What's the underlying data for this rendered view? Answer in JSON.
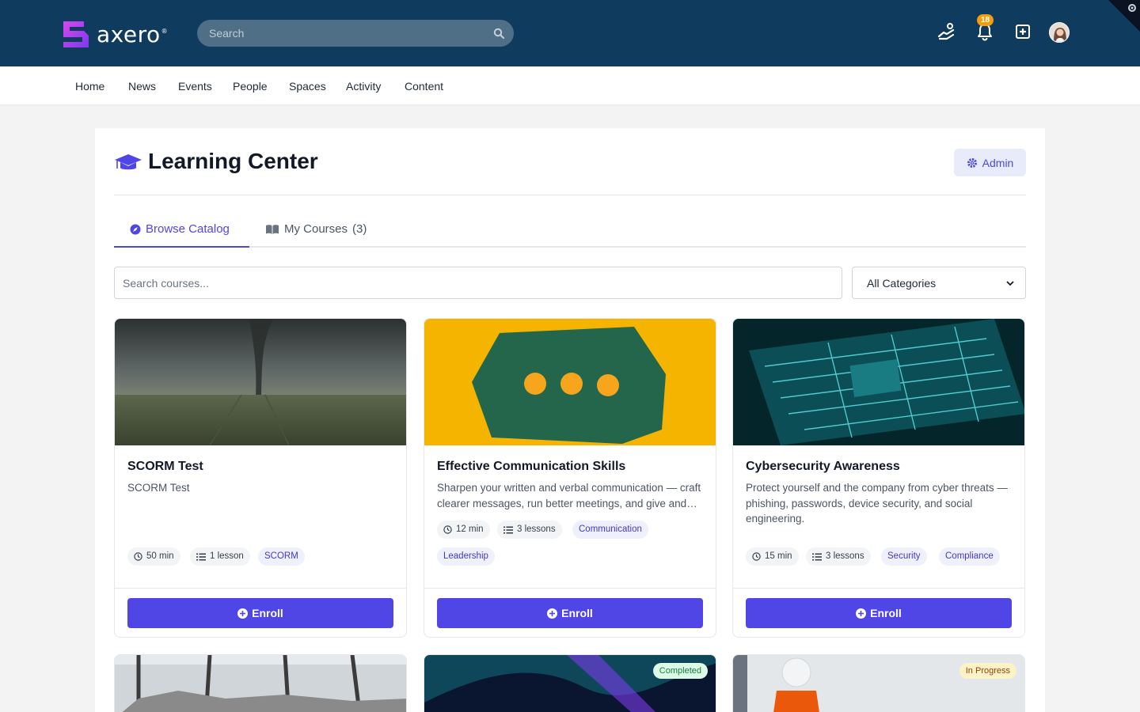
{
  "app": {
    "brand": "axero",
    "brand_mark": "®"
  },
  "header": {
    "search_placeholder": "Search",
    "notification_count": "18"
  },
  "nav": {
    "items": [
      "Home",
      "News",
      "Events",
      "People",
      "Spaces",
      "Activity",
      "Content"
    ]
  },
  "page": {
    "title": "Learning Center",
    "admin_label": "Admin"
  },
  "tabs": [
    {
      "label": "Browse Catalog"
    },
    {
      "label": "My Courses",
      "count": "(3)"
    }
  ],
  "filters": {
    "search_placeholder": "Search courses...",
    "category_selected": "All Categories"
  },
  "courses": [
    {
      "title": "SCORM Test",
      "description": "SCORM Test",
      "duration": "50 min",
      "lessons": "1 lesson",
      "tags": [
        "SCORM"
      ],
      "action": "Enroll"
    },
    {
      "title": "Effective Communication Skills",
      "description": "Sharpen your written and verbal communication — craft clearer messages, run better meetings, and give and receive feedback.",
      "duration": "12 min",
      "lessons": "3 lessons",
      "tags": [
        "Communication",
        "Leadership"
      ],
      "action": "Enroll"
    },
    {
      "title": "Cybersecurity Awareness",
      "description": "Protect yourself and the company from cyber threats — phishing, passwords, device security, and social engineering.",
      "duration": "15 min",
      "lessons": "3 lessons",
      "tags": [
        "Security",
        "Compliance"
      ],
      "action": "Enroll"
    }
  ],
  "more_courses": [
    {
      "status": ""
    },
    {
      "status": "Completed"
    },
    {
      "status": "In Progress"
    }
  ],
  "colors": {
    "header_bg": "#0e3b5e",
    "accent": "#4f46e5",
    "logo": "#c040e0"
  },
  "icons": [
    "search-icon",
    "handshake-icon",
    "bell-icon",
    "plus-square-icon",
    "gear-icon",
    "graduation-cap-icon",
    "compass-icon",
    "book-open-icon",
    "clock-icon",
    "list-icon",
    "plus-circle-icon",
    "chevron-down-icon"
  ]
}
